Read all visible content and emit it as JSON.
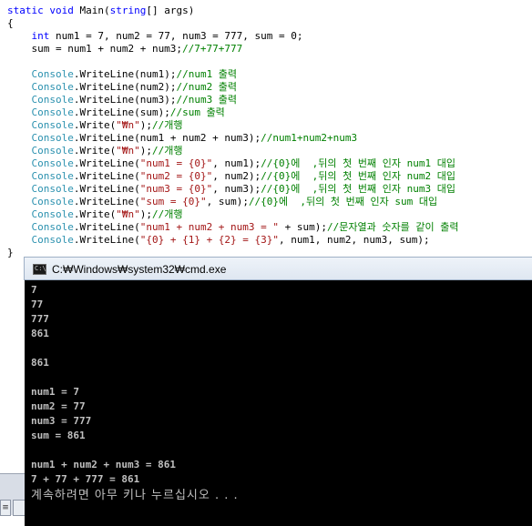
{
  "code_lines": [
    [
      {
        "t": "static",
        "c": "kw"
      },
      {
        "t": " ",
        "c": "pl"
      },
      {
        "t": "void",
        "c": "kw"
      },
      {
        "t": " Main(",
        "c": "pl"
      },
      {
        "t": "string",
        "c": "kw"
      },
      {
        "t": "[] args)",
        "c": "pl"
      }
    ],
    [
      {
        "t": "{",
        "c": "pl"
      }
    ],
    [
      {
        "t": "    ",
        "c": "pl"
      },
      {
        "t": "int",
        "c": "kw"
      },
      {
        "t": " num1 = 7, num2 = 77, num3 = 777, sum = 0;",
        "c": "pl"
      }
    ],
    [
      {
        "t": "    sum = num1 + num2 + num3;",
        "c": "pl"
      },
      {
        "t": "//7+77+777",
        "c": "cm"
      }
    ],
    [],
    [
      {
        "t": "    ",
        "c": "pl"
      },
      {
        "t": "Console",
        "c": "ty"
      },
      {
        "t": ".WriteLine(num1);",
        "c": "pl"
      },
      {
        "t": "//num1 출력",
        "c": "cm"
      }
    ],
    [
      {
        "t": "    ",
        "c": "pl"
      },
      {
        "t": "Console",
        "c": "ty"
      },
      {
        "t": ".WriteLine(num2);",
        "c": "pl"
      },
      {
        "t": "//num2 출력",
        "c": "cm"
      }
    ],
    [
      {
        "t": "    ",
        "c": "pl"
      },
      {
        "t": "Console",
        "c": "ty"
      },
      {
        "t": ".WriteLine(num3);",
        "c": "pl"
      },
      {
        "t": "//num3 출력",
        "c": "cm"
      }
    ],
    [
      {
        "t": "    ",
        "c": "pl"
      },
      {
        "t": "Console",
        "c": "ty"
      },
      {
        "t": ".WriteLine(sum);",
        "c": "pl"
      },
      {
        "t": "//sum 출력",
        "c": "cm"
      }
    ],
    [
      {
        "t": "    ",
        "c": "pl"
      },
      {
        "t": "Console",
        "c": "ty"
      },
      {
        "t": ".Write(",
        "c": "pl"
      },
      {
        "t": "\"₩n\"",
        "c": "str"
      },
      {
        "t": ");",
        "c": "pl"
      },
      {
        "t": "//개행",
        "c": "cm"
      }
    ],
    [
      {
        "t": "    ",
        "c": "pl"
      },
      {
        "t": "Console",
        "c": "ty"
      },
      {
        "t": ".WriteLine(num1 + num2 + num3);",
        "c": "pl"
      },
      {
        "t": "//num1+num2+num3",
        "c": "cm"
      }
    ],
    [
      {
        "t": "    ",
        "c": "pl"
      },
      {
        "t": "Console",
        "c": "ty"
      },
      {
        "t": ".Write(",
        "c": "pl"
      },
      {
        "t": "\"₩n\"",
        "c": "str"
      },
      {
        "t": ");",
        "c": "pl"
      },
      {
        "t": "//개행",
        "c": "cm"
      }
    ],
    [
      {
        "t": "    ",
        "c": "pl"
      },
      {
        "t": "Console",
        "c": "ty"
      },
      {
        "t": ".WriteLine(",
        "c": "pl"
      },
      {
        "t": "\"num1 = {0}\"",
        "c": "str"
      },
      {
        "t": ", num1);",
        "c": "pl"
      },
      {
        "t": "//{0}에  ,뒤의 첫 번째 인자 num1 대입",
        "c": "cm"
      }
    ],
    [
      {
        "t": "    ",
        "c": "pl"
      },
      {
        "t": "Console",
        "c": "ty"
      },
      {
        "t": ".WriteLine(",
        "c": "pl"
      },
      {
        "t": "\"num2 = {0}\"",
        "c": "str"
      },
      {
        "t": ", num2);",
        "c": "pl"
      },
      {
        "t": "//{0}에  ,뒤의 첫 번째 인자 num2 대입",
        "c": "cm"
      }
    ],
    [
      {
        "t": "    ",
        "c": "pl"
      },
      {
        "t": "Console",
        "c": "ty"
      },
      {
        "t": ".WriteLine(",
        "c": "pl"
      },
      {
        "t": "\"num3 = {0}\"",
        "c": "str"
      },
      {
        "t": ", num3);",
        "c": "pl"
      },
      {
        "t": "//{0}에  ,뒤의 첫 번째 인자 num3 대입",
        "c": "cm"
      }
    ],
    [
      {
        "t": "    ",
        "c": "pl"
      },
      {
        "t": "Console",
        "c": "ty"
      },
      {
        "t": ".WriteLine(",
        "c": "pl"
      },
      {
        "t": "\"sum = {0}\"",
        "c": "str"
      },
      {
        "t": ", sum);",
        "c": "pl"
      },
      {
        "t": "//{0}에  ,뒤의 첫 번째 인자 sum 대입",
        "c": "cm"
      }
    ],
    [
      {
        "t": "    ",
        "c": "pl"
      },
      {
        "t": "Console",
        "c": "ty"
      },
      {
        "t": ".Write(",
        "c": "pl"
      },
      {
        "t": "\"₩n\"",
        "c": "str"
      },
      {
        "t": ");",
        "c": "pl"
      },
      {
        "t": "//개행",
        "c": "cm"
      }
    ],
    [
      {
        "t": "    ",
        "c": "pl"
      },
      {
        "t": "Console",
        "c": "ty"
      },
      {
        "t": ".WriteLine(",
        "c": "pl"
      },
      {
        "t": "\"num1 + num2 + num3 = \"",
        "c": "str"
      },
      {
        "t": " + sum);",
        "c": "pl"
      },
      {
        "t": "//문자열과 숫자를 같이 출력",
        "c": "cm"
      }
    ],
    [
      {
        "t": "    ",
        "c": "pl"
      },
      {
        "t": "Console",
        "c": "ty"
      },
      {
        "t": ".WriteLine(",
        "c": "pl"
      },
      {
        "t": "\"{0} + {1} + {2} = {3}\"",
        "c": "str"
      },
      {
        "t": ", num1, num2, num3, sum);",
        "c": "pl"
      }
    ],
    [
      {
        "t": "}",
        "c": "pl"
      }
    ]
  ],
  "cmd_window": {
    "title": "C:₩Windows₩system32₩cmd.exe",
    "icon_glyph": "C:\\",
    "output": [
      "7",
      "77",
      "777",
      "861",
      "",
      "861",
      "",
      "num1 = 7",
      "num2 = 77",
      "num3 = 777",
      "sum = 861",
      "",
      "num1 + num2 + num3 = 861",
      "7 + 77 + 777 = 861"
    ],
    "prompt": "계속하려면 아무 키나 누르십시오 . . ."
  },
  "left_strip": {
    "tab_glyph": "≡"
  }
}
